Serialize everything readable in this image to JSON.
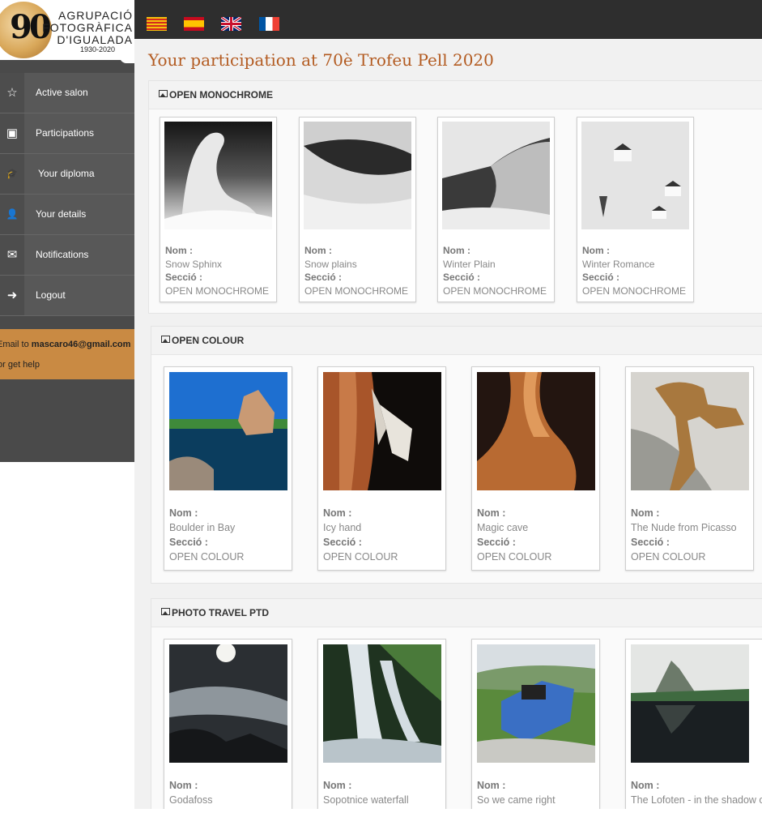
{
  "logo": {
    "number": "90",
    "line1": "AGRUPACIÓ",
    "line2": "FOTOGRÀFICA",
    "line3": "D'IGUALADA",
    "years": "1930-2020"
  },
  "sidebar": {
    "items": [
      {
        "label": "Active salon",
        "icon": "star-icon",
        "glyph": "☆"
      },
      {
        "label": "Participations",
        "icon": "book-icon",
        "glyph": "▣"
      },
      {
        "label": "Your diploma",
        "icon": "graduation-cap-icon",
        "glyph": "🎓"
      },
      {
        "label": "Your details",
        "icon": "user-icon",
        "glyph": "👤"
      },
      {
        "label": "Notifications",
        "icon": "envelope-icon",
        "glyph": "✉"
      },
      {
        "label": "Logout",
        "icon": "logout-icon",
        "glyph": "➜"
      }
    ],
    "help": {
      "prefix": "Email to ",
      "email": "mascaro46@gmail.com",
      "suffix": "or get help"
    }
  },
  "languages": [
    "Catalan",
    "Spanish",
    "English",
    "French"
  ],
  "page_title": "Your participation at 70è Trofeu Pell 2020",
  "labels": {
    "name": "Nom :",
    "section": "Secció :"
  },
  "sections": [
    {
      "title": "OPEN MONOCHROME",
      "entries": [
        {
          "name": "Snow Sphinx",
          "section": "OPEN MONOCHROME"
        },
        {
          "name": "Snow plains",
          "section": "OPEN MONOCHROME"
        },
        {
          "name": "Winter Plain",
          "section": "OPEN MONOCHROME"
        },
        {
          "name": "Winter Romance",
          "section": "OPEN MONOCHROME"
        }
      ]
    },
    {
      "title": "OPEN COLOUR",
      "entries": [
        {
          "name": "Boulder in Bay",
          "section": "OPEN COLOUR"
        },
        {
          "name": "Icy hand",
          "section": "OPEN COLOUR"
        },
        {
          "name": "Magic cave",
          "section": "OPEN COLOUR"
        },
        {
          "name": "The Nude from Picasso",
          "section": "OPEN COLOUR"
        }
      ]
    },
    {
      "title": "PHOTO TRAVEL PTD",
      "entries": [
        {
          "name": "Godafoss"
        },
        {
          "name": "Sopotnice waterfall"
        },
        {
          "name": "So we came right"
        },
        {
          "name": "The Lofoten - in the shadow of"
        }
      ]
    }
  ],
  "colors": {
    "accent": "#b35b21",
    "sidebar": "#4a4a4a",
    "help_box": "#c98a43",
    "topbar": "#2e2e2e"
  }
}
